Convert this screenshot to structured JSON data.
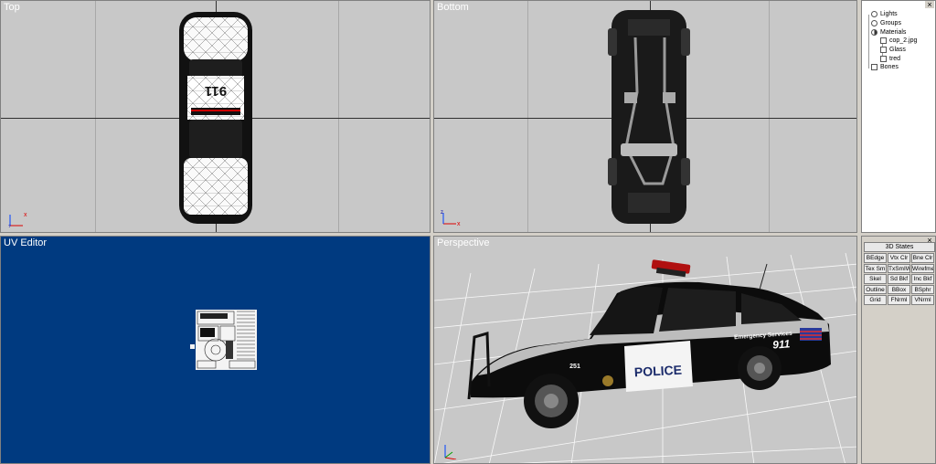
{
  "viewports": {
    "top": {
      "label": "Top"
    },
    "bottom": {
      "label": "Bottom"
    },
    "uv": {
      "label": "UV Editor"
    },
    "perspective": {
      "label": "Perspective"
    }
  },
  "car": {
    "roof_number": "911",
    "door_text": "POLICE",
    "rear_text": "Emergency Services",
    "rear_number": "911",
    "unit_number": "251"
  },
  "tree": {
    "items": [
      {
        "label": "Lights",
        "icon": "light-icon"
      },
      {
        "label": "Groups",
        "icon": "groups-icon"
      },
      {
        "label": "Materials",
        "icon": "materials-icon"
      },
      {
        "label": "cop_2.jpg",
        "icon": "texture-icon"
      },
      {
        "label": "Glass",
        "icon": "material-icon"
      },
      {
        "label": "tred",
        "icon": "texture-icon"
      },
      {
        "label": "Bones",
        "icon": "bones-icon"
      }
    ]
  },
  "states_panel": {
    "header": "3D States",
    "buttons": [
      "BEdge",
      "Vtx Clr",
      "Bne Clr",
      "Tex Sm",
      "TxSmIWr",
      "Wirefme",
      "Skel",
      "Sd Bkf",
      "Inc Bkf",
      "Outline",
      "BBox",
      "BSphr",
      "Grid",
      "FNrml",
      "VNrml"
    ]
  },
  "colors": {
    "viewport_bg": "#c8c8c8",
    "uv_bg": "#003a80",
    "panel_bg": "#d4d0c8"
  }
}
